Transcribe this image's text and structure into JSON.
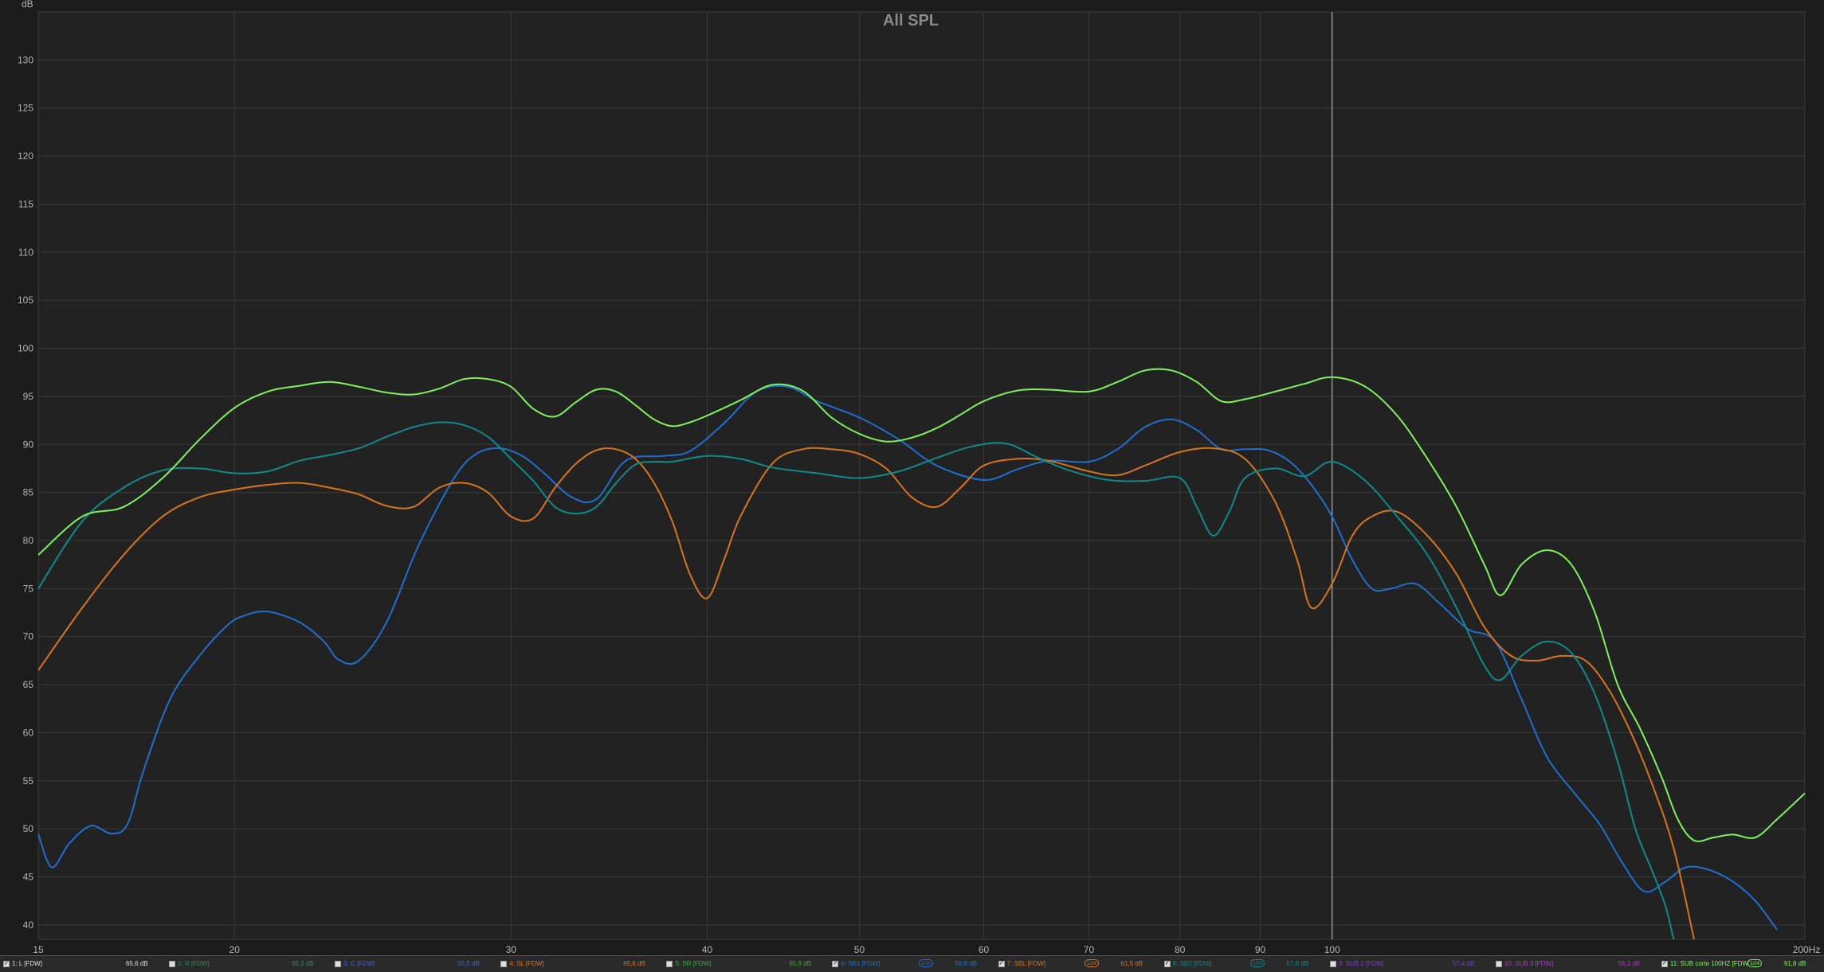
{
  "chart_data": {
    "type": "line",
    "title": "All SPL",
    "ylabel": "dB",
    "x_unit": "Hz",
    "xscale": "log",
    "xlim": [
      15,
      200
    ],
    "ylim": [
      38.5,
      135
    ],
    "x_ticks": [
      {
        "value": 15,
        "label": "15"
      },
      {
        "value": 20,
        "label": "20"
      },
      {
        "value": 30,
        "label": "30"
      },
      {
        "value": 40,
        "label": "40"
      },
      {
        "value": 50,
        "label": "50"
      },
      {
        "value": 60,
        "label": "60"
      },
      {
        "value": 70,
        "label": "70"
      },
      {
        "value": 80,
        "label": "80"
      },
      {
        "value": 90,
        "label": "90"
      },
      {
        "value": 100,
        "label": "100"
      },
      {
        "value": 200,
        "label": "200Hz"
      }
    ],
    "y_ticks": [
      40,
      45,
      50,
      55,
      60,
      65,
      70,
      75,
      80,
      85,
      90,
      95,
      100,
      105,
      110,
      115,
      120,
      125,
      130
    ],
    "grid": true,
    "cursor_x": 100,
    "series": [
      {
        "color": "#1e6fd0",
        "x": [
          15,
          15.3,
          15.7,
          16.2,
          16.7,
          17.1,
          17.5,
          18.2,
          19,
          19.8,
          20.3,
          21,
          22,
          22.8,
          23.3,
          24,
          25,
          26.2,
          27.6,
          28.5,
          29.5,
          30.5,
          31.5,
          32.8,
          34,
          35.5,
          37.5,
          39,
          41,
          43,
          45,
          47,
          50,
          53,
          56,
          60,
          63,
          66,
          70,
          73,
          76,
          79,
          82,
          85,
          88,
          91,
          94,
          97,
          100,
          103,
          106,
          109,
          113,
          117,
          122,
          127,
          132,
          137,
          143,
          148,
          153,
          158,
          163,
          168,
          174,
          180,
          186,
          192
        ],
        "y": [
          49.5,
          46,
          48.5,
          50.3,
          49.5,
          50.5,
          56,
          63.5,
          68,
          71.2,
          72.2,
          72.6,
          71.5,
          69.5,
          67.6,
          67.5,
          71.5,
          79.5,
          86.5,
          89,
          89.6,
          88.8,
          87,
          84.5,
          84.3,
          88.3,
          88.8,
          89.3,
          92.2,
          95.5,
          96,
          94.5,
          92.8,
          90.5,
          87.8,
          86.3,
          87.4,
          88.3,
          88.2,
          89.5,
          91.8,
          92.6,
          91.5,
          89.5,
          89.5,
          89.4,
          88.2,
          85.8,
          82.5,
          78,
          75,
          75,
          75.5,
          73.5,
          70.8,
          69.5,
          63.5,
          57.5,
          53.5,
          50.5,
          46.5,
          43.5,
          44.5,
          46,
          45.7,
          44.5,
          42.5,
          39.5
        ]
      },
      {
        "color": "#d7751c",
        "x": [
          15,
          16,
          17,
          18,
          19,
          20,
          21,
          22,
          23,
          24,
          25,
          26,
          27,
          28,
          29,
          30,
          31,
          32,
          33,
          34,
          35,
          36,
          37,
          38,
          39,
          40,
          41,
          42,
          44,
          46,
          48,
          50,
          52,
          54,
          56,
          58,
          60,
          63,
          66,
          70,
          73,
          76,
          80,
          84,
          88,
          92,
          95,
          97,
          100,
          103,
          106,
          110,
          115,
          120,
          125,
          130,
          135,
          140,
          145,
          150,
          155,
          160,
          165,
          170
        ],
        "y": [
          66.5,
          73,
          78.5,
          82.5,
          84.5,
          85.3,
          85.8,
          86,
          85.5,
          84.8,
          83.6,
          83.5,
          85.5,
          86,
          85,
          82.5,
          82.3,
          85.5,
          88,
          89.4,
          89.5,
          88.5,
          86,
          82,
          76.5,
          74,
          78,
          82.5,
          88,
          89.5,
          89.5,
          89,
          87.5,
          84.5,
          83.5,
          85.5,
          87.8,
          88.5,
          88.3,
          87.2,
          86.8,
          87.8,
          89.2,
          89.6,
          88.5,
          84,
          78,
          73,
          75.5,
          80.5,
          82.5,
          83,
          80.5,
          76.5,
          71,
          68,
          67.5,
          68,
          67.5,
          64.5,
          60,
          54.5,
          48,
          38.5
        ]
      },
      {
        "color": "#0f8a8a",
        "x": [
          15,
          16,
          17,
          18,
          19,
          20,
          21,
          22,
          23,
          24,
          25,
          26,
          27,
          28,
          29,
          30,
          31,
          32,
          33,
          34,
          35,
          36,
          37,
          38,
          40,
          42,
          44,
          47,
          50,
          53,
          56,
          59,
          62,
          65,
          68,
          72,
          76,
          80,
          82,
          84,
          86,
          88,
          92,
          96,
          100,
          105,
          110,
          115,
          120,
          125,
          128,
          132,
          137,
          142,
          147,
          152,
          156,
          160,
          163,
          165
        ],
        "y": [
          75,
          82,
          85.5,
          87.3,
          87.5,
          87,
          87.2,
          88.3,
          88.9,
          89.6,
          90.8,
          91.8,
          92.3,
          92,
          90.8,
          88.5,
          86.2,
          83.5,
          82.8,
          83.5,
          86,
          87.9,
          88.2,
          88.2,
          88.8,
          88.5,
          87.6,
          87,
          86.5,
          87.2,
          88.6,
          89.8,
          90.1,
          88.6,
          87.3,
          86.3,
          86.2,
          86.5,
          83.5,
          80.5,
          83,
          86.5,
          87.5,
          86.7,
          88.2,
          86.2,
          82.5,
          78.5,
          73,
          67,
          65.5,
          68,
          69.5,
          68.3,
          64,
          57,
          50,
          45.5,
          42,
          38.5
        ]
      },
      {
        "color": "#7ef35a",
        "x": [
          15,
          16,
          17,
          18,
          19,
          20,
          21,
          22,
          23,
          24,
          25,
          26,
          27,
          28,
          29,
          30,
          31,
          32,
          33,
          34,
          35,
          36,
          37,
          38,
          39,
          40,
          42,
          44,
          46,
          48,
          50,
          52,
          54,
          56,
          58,
          60,
          63,
          66,
          70,
          73,
          76,
          79,
          82,
          85,
          88,
          92,
          96,
          100,
          105,
          110,
          115,
          120,
          125,
          128,
          132,
          137,
          142,
          147,
          152,
          157,
          162,
          166,
          170,
          175,
          180,
          186,
          192,
          200
        ],
        "y": [
          78.5,
          82.5,
          83.5,
          86.5,
          90.5,
          93.8,
          95.5,
          96.1,
          96.5,
          96,
          95.4,
          95.2,
          95.8,
          96.8,
          96.8,
          96,
          93.7,
          92.9,
          94.4,
          95.7,
          95.5,
          94.1,
          92.6,
          91.9,
          92.3,
          93,
          94.6,
          96.2,
          95.6,
          92.8,
          91.1,
          90.3,
          90.7,
          91.7,
          93.1,
          94.5,
          95.6,
          95.7,
          95.5,
          96.5,
          97.7,
          97.7,
          96.5,
          94.5,
          94.7,
          95.5,
          96.3,
          97,
          96,
          93,
          88.5,
          83.5,
          77.5,
          74.3,
          77.5,
          79,
          77.5,
          72.5,
          65,
          60.5,
          55.5,
          51,
          48.8,
          49.1,
          49.4,
          49.1,
          51,
          53.7
        ]
      }
    ]
  },
  "legend": {
    "items": [
      {
        "checked": true,
        "name": "1: L [FDW]",
        "value": "65,6 dB",
        "color": "#e0e0e0",
        "value_color": "#e0e0e0",
        "badge": ""
      },
      {
        "checked": false,
        "name": "2: R [FDW]",
        "value": "65,3 dB",
        "color": "#2e8b57",
        "value_color": "#2e8b57",
        "badge": ""
      },
      {
        "checked": false,
        "name": "3: C [FDW]",
        "value": "65,5 dB",
        "color": "#4a5fd6",
        "value_color": "#4a5fd6",
        "badge": ""
      },
      {
        "checked": false,
        "name": "4: SL [FDW]",
        "value": "65,6 dB",
        "color": "#d7751c",
        "value_color": "#d7751c",
        "badge": ""
      },
      {
        "checked": false,
        "name": "5: SR [FDW]",
        "value": "65,9 dB",
        "color": "#3aa845",
        "value_color": "#3aa845",
        "badge": ""
      },
      {
        "checked": true,
        "name": "6: SB1 [FDW]",
        "value": "58,8 dB",
        "color": "#1e6fd0",
        "value_color": "#1e6fd0",
        "badge": "1/24"
      },
      {
        "checked": true,
        "name": "7: SBL [FDW]",
        "value": "61,5 dB",
        "color": "#d7751c",
        "value_color": "#d7751c",
        "badge": "1/24"
      },
      {
        "checked": true,
        "name": "8: SB2 [FDW]",
        "value": "57,8 dB",
        "color": "#0f8a8a",
        "value_color": "#0f8a8a",
        "badge": "1/24"
      },
      {
        "checked": false,
        "name": "9: SUB 2 [FDW]",
        "value": "57,4 dB",
        "color": "#7a3fd0",
        "value_color": "#7a3fd0",
        "badge": ""
      },
      {
        "checked": false,
        "name": "10: SUB 3 [FDW]",
        "value": "56,2 dB",
        "color": "#a63fb8",
        "value_color": "#a63fb8",
        "badge": ""
      },
      {
        "checked": true,
        "name": "11: SUB corte 100HZ [FDW",
        "value": "91,8 dB",
        "color": "#7ef35a",
        "value_color": "#7ef35a",
        "badge": "1/24"
      }
    ]
  }
}
